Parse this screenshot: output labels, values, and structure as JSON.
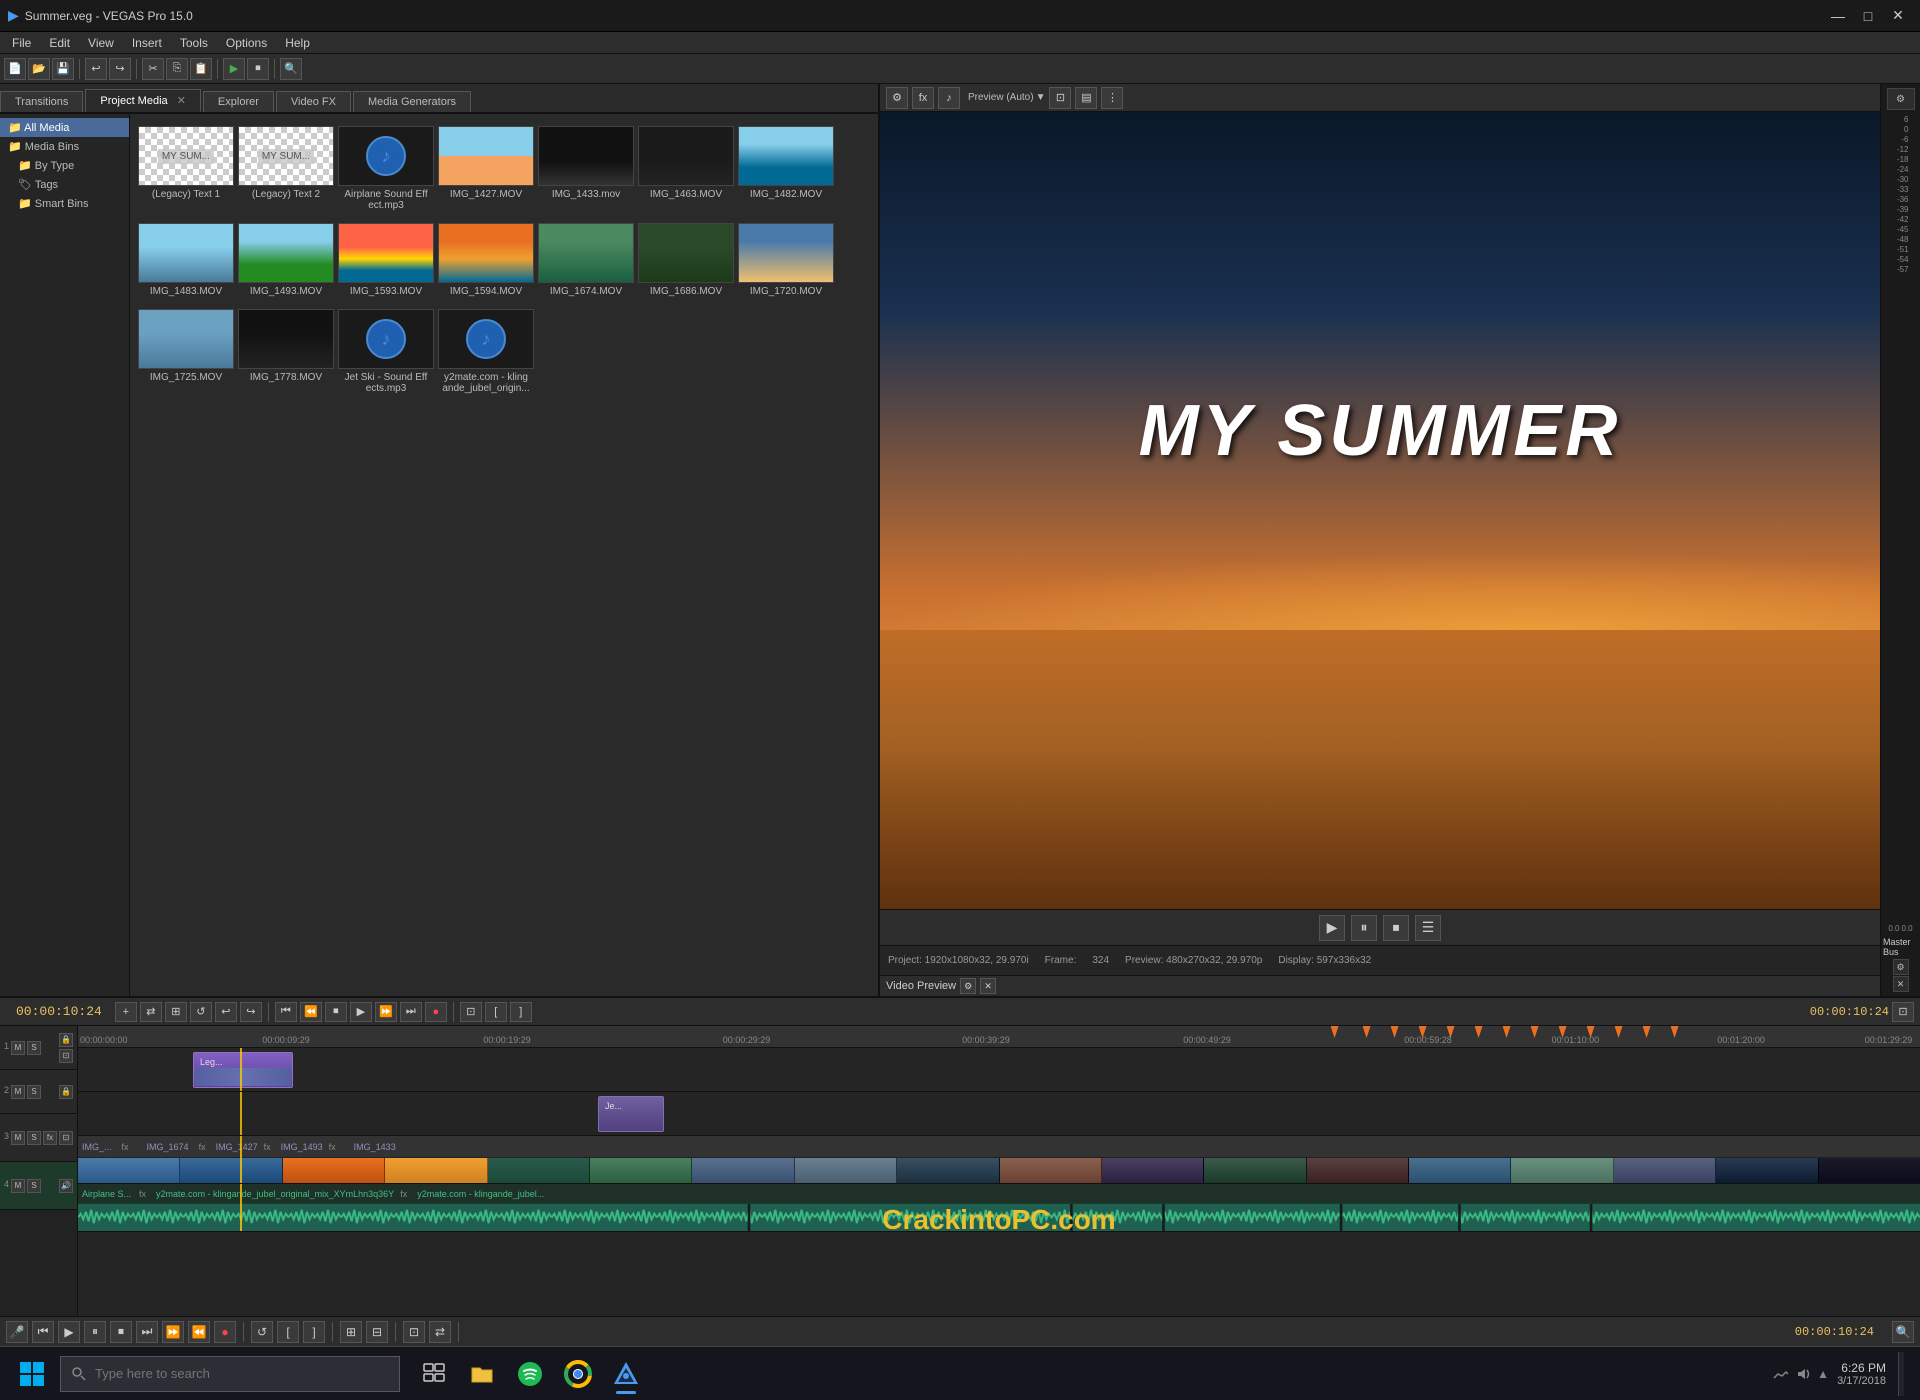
{
  "titlebar": {
    "title": "Summer.veg - VEGAS Pro 15.0",
    "min_label": "—",
    "max_label": "□",
    "close_label": "✕"
  },
  "menu": {
    "items": [
      "File",
      "Edit",
      "View",
      "Insert",
      "Tools",
      "Options",
      "Help"
    ]
  },
  "media_tree": {
    "items": [
      {
        "label": "All Media",
        "indent": false,
        "selected": true
      },
      {
        "label": "Media Bins",
        "indent": false,
        "selected": false
      },
      {
        "label": "By Type",
        "indent": true,
        "selected": false
      },
      {
        "label": "Tags",
        "indent": true,
        "selected": false
      },
      {
        "label": "Smart Bins",
        "indent": true,
        "selected": false
      }
    ]
  },
  "media_items": [
    {
      "label": "(Legacy) Text 1",
      "type": "text"
    },
    {
      "label": "(Legacy) Text 2",
      "type": "text"
    },
    {
      "label": "Airplane Sound Effect.mp3",
      "type": "audio"
    },
    {
      "label": "IMG_1427.MOV",
      "type": "beach"
    },
    {
      "label": "IMG_1433.mov",
      "type": "dark"
    },
    {
      "label": "IMG_1463.MOV",
      "type": "dark2"
    },
    {
      "label": "IMG_1482.MOV",
      "type": "ocean"
    },
    {
      "label": "IMG_1483.MOV",
      "type": "beach2"
    },
    {
      "label": "IMG_1493.MOV",
      "type": "forest"
    },
    {
      "label": "IMG_1593.MOV",
      "type": "sunset"
    },
    {
      "label": "IMG_1594.MOV",
      "type": "sunset2"
    },
    {
      "label": "IMG_1674.MOV",
      "type": "water"
    },
    {
      "label": "IMG_1686.MOV",
      "type": "forest2"
    },
    {
      "label": "IMG_1720.MOV",
      "type": "sand"
    },
    {
      "label": "IMG_1725.MOV",
      "type": "sky"
    },
    {
      "label": "IMG_1778.MOV",
      "type": "dark3"
    },
    {
      "label": "Jet Ski - Sound Effects.mp3",
      "type": "audio"
    },
    {
      "label": "y2mate.com - klingande_jubel_origin...",
      "type": "audio"
    }
  ],
  "tabs": [
    {
      "label": "Transitions",
      "active": false,
      "closeable": false
    },
    {
      "label": "Project Media",
      "active": true,
      "closeable": true
    },
    {
      "label": "Explorer",
      "active": false,
      "closeable": false
    },
    {
      "label": "Video FX",
      "active": false,
      "closeable": false
    },
    {
      "label": "Media Generators",
      "active": false,
      "closeable": false
    }
  ],
  "preview": {
    "title": "MY SUMMER",
    "project_info": "Project: 1920x1080x32, 29.970i",
    "preview_info": "Preview: 480x270x32, 29.970p",
    "display_info": "Display: 597x336x32",
    "frame": "324",
    "frame_label": "Frame:"
  },
  "timeline": {
    "timecode": "00:00:10:24",
    "end_timecode": "00:00:10:24",
    "tracks": [
      {
        "num": "1",
        "type": "video"
      },
      {
        "num": "2",
        "type": "video"
      },
      {
        "num": "3",
        "type": "video"
      },
      {
        "num": "4",
        "type": "audio"
      }
    ],
    "ruler_marks": [
      "00:00:00:00",
      "00:00:09:29",
      "00:00:19:29",
      "00:00:29:29",
      "00:00:39:29",
      "00:00:49:29",
      "00:00:59:28",
      "00:01:10:00",
      "00:01:20:00",
      "00:01:29:29"
    ]
  },
  "transport": {
    "timecode": "00:00:10:24"
  },
  "taskbar": {
    "search_placeholder": "Type here to search",
    "time": "6:26 PM",
    "date": "3/17/2018"
  },
  "watermark": "CrackintoPC.com"
}
